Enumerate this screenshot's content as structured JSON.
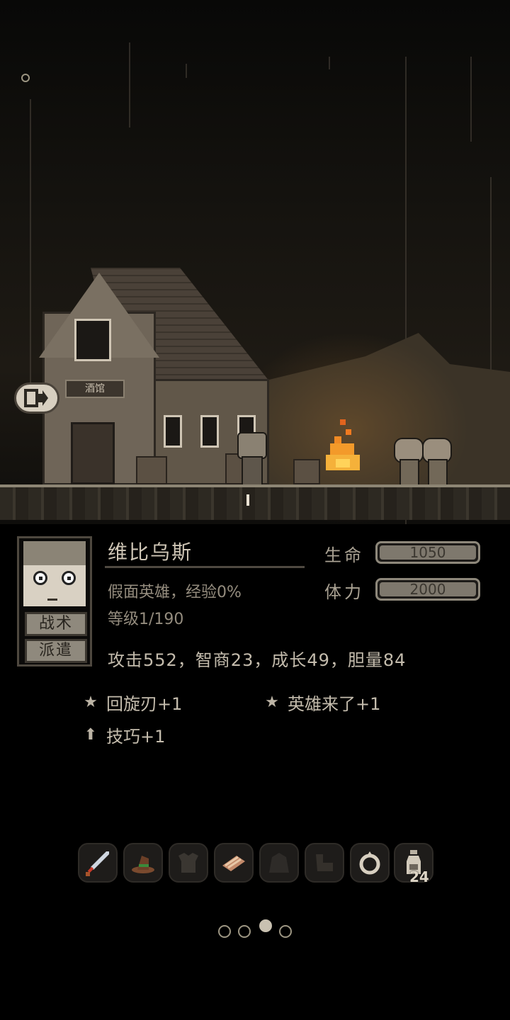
{
  "scene": {
    "tavern_sign": "酒馆"
  },
  "hero": {
    "name": "维比乌斯",
    "class_exp": "假面英雄，经验0%",
    "level": "等级1/190",
    "attributes": "攻击552，智商23，成长49，胆量84",
    "hp_label": "生命",
    "hp_value": "1050",
    "stamina_label": "体力",
    "stamina_value": "2000",
    "tactics_button": "战术",
    "dispatch_button": "派遣"
  },
  "skills": [
    {
      "icon": "star-icon",
      "label": "回旋刃+1"
    },
    {
      "icon": "star-icon",
      "label": "英雄来了+1"
    },
    {
      "icon": "up-arrow-icon",
      "label": "技巧+1"
    }
  ],
  "inventory": {
    "items": [
      "sword-icon",
      "hat-icon",
      "armor-icon",
      "bread-icon",
      "cloak-icon",
      "gloves-icon",
      "ring-icon",
      "potion-icon"
    ],
    "potion_count": "24"
  },
  "pagination": {
    "total": 4,
    "active_index": 2
  }
}
